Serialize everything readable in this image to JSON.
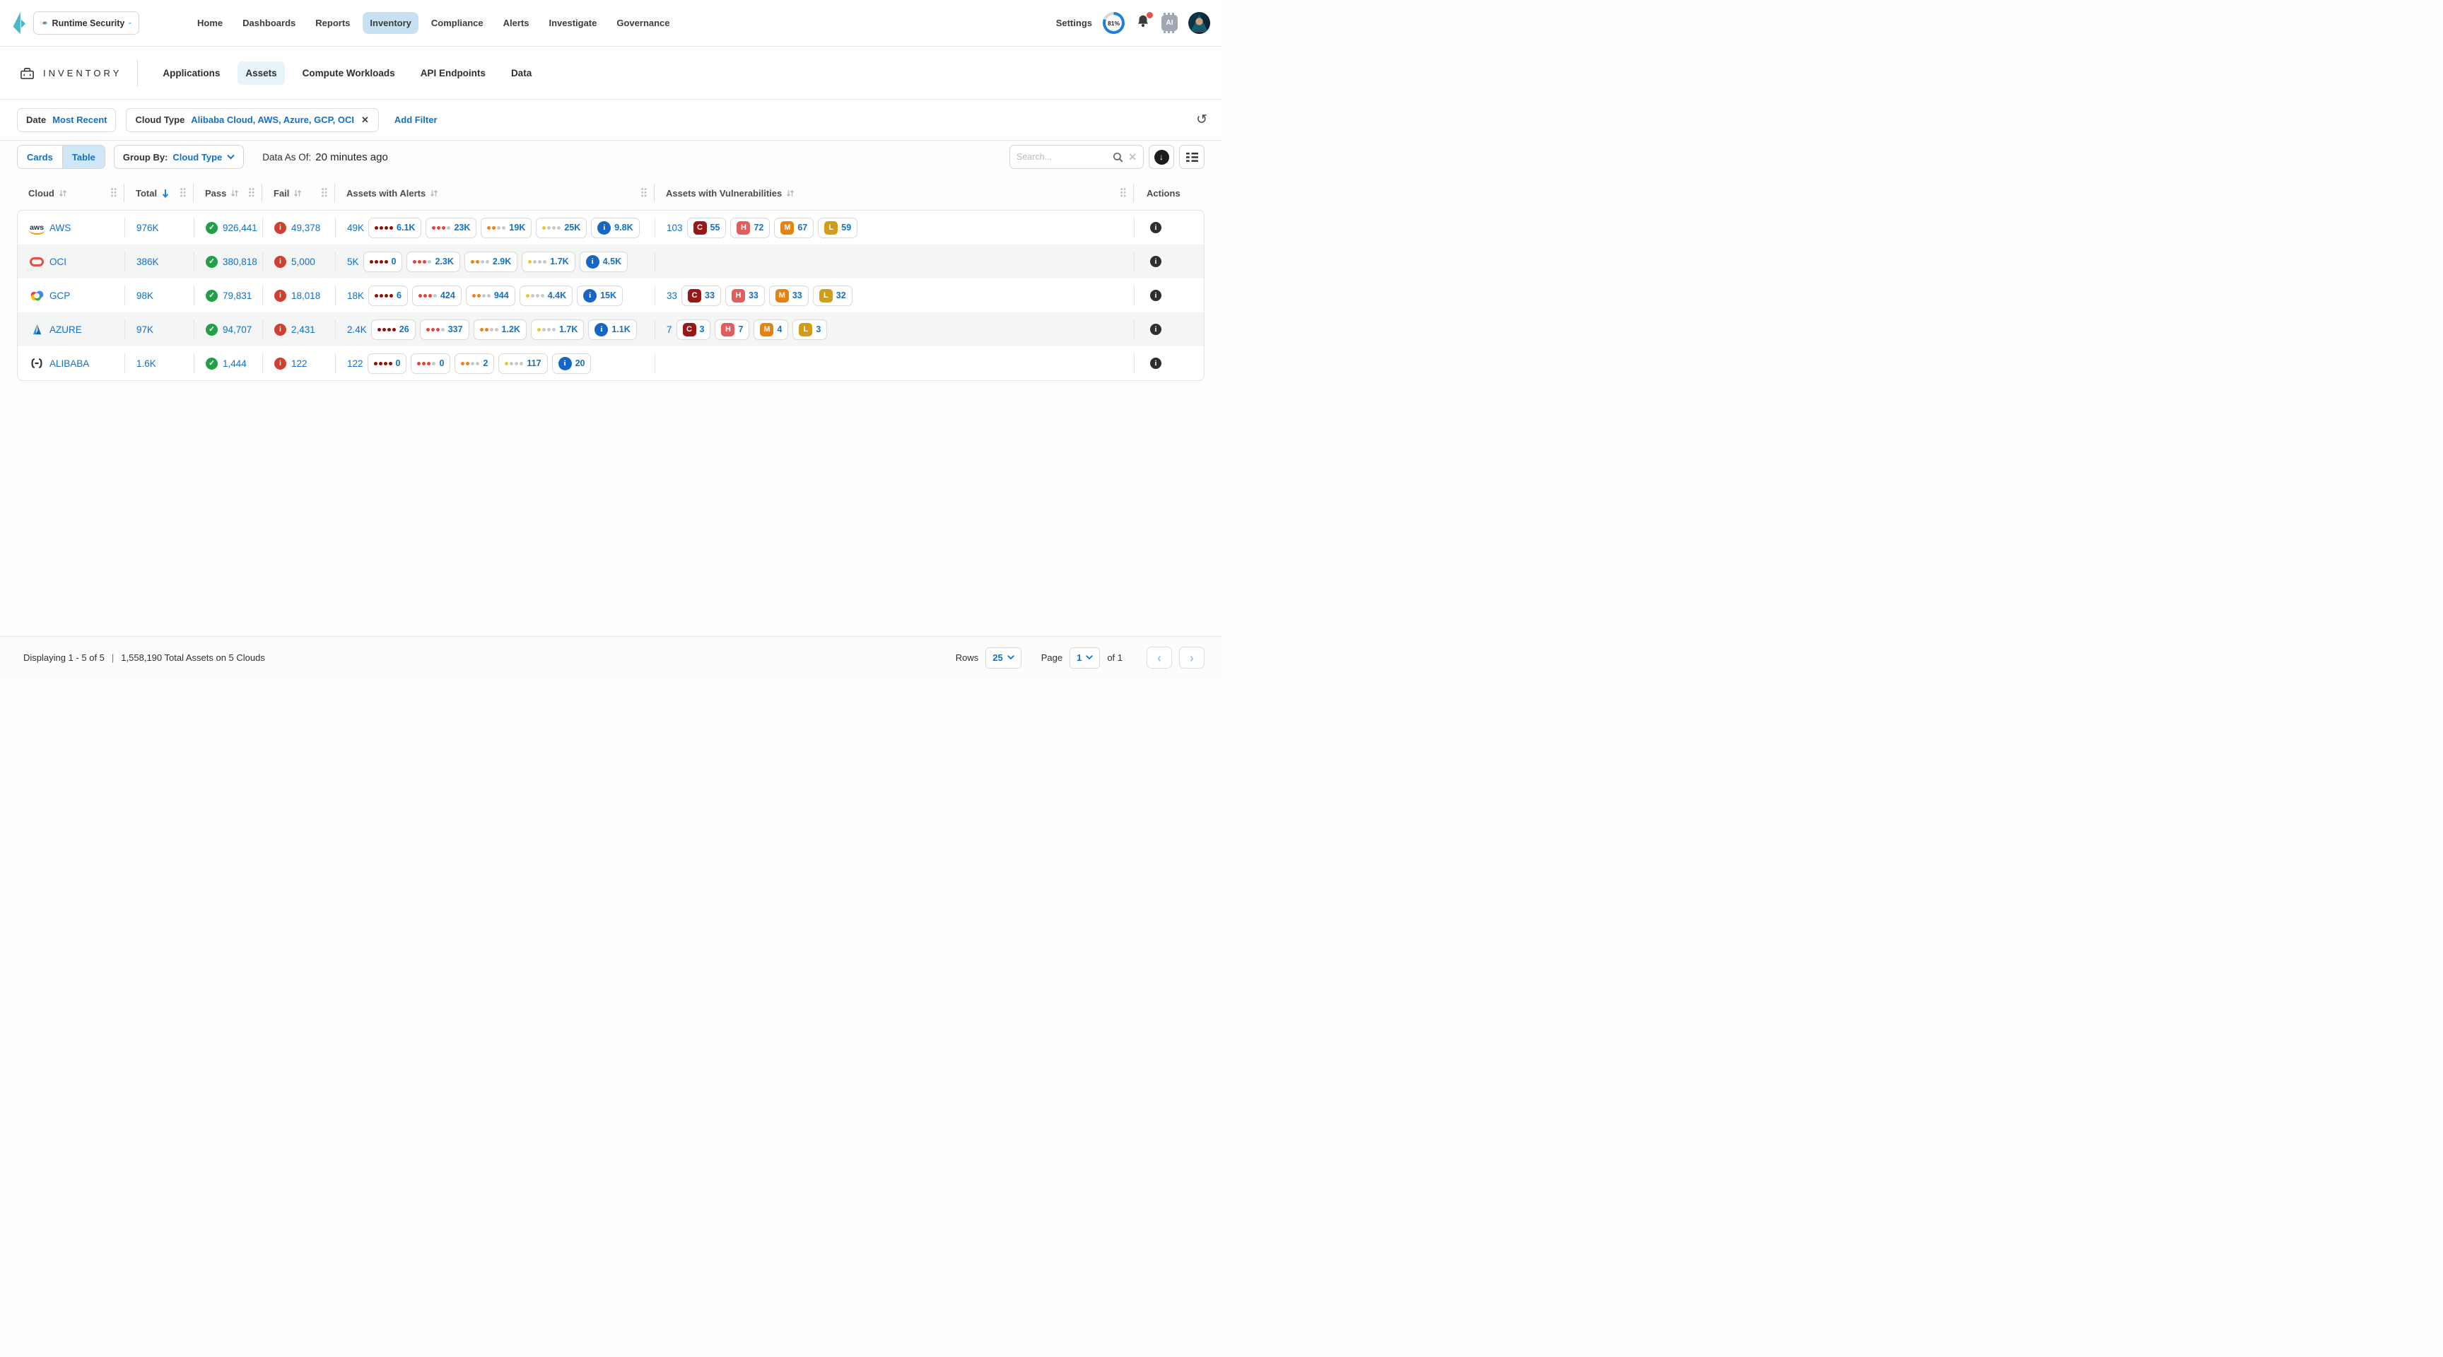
{
  "colors": {
    "accent_blue": "#1171c9",
    "active_nav_bg": "#c6e2f2",
    "active_tab_bg": "#e8f4fb",
    "pass_green": "#23a047",
    "fail_red": "#d23f31",
    "severity_critical": "#8e1010",
    "severity_high": "#e0463e",
    "severity_medium": "#e8821d",
    "severity_low": "#ecc531",
    "severity_info": "#1566c9",
    "brand_teal": "#4db6c8"
  },
  "top_nav": {
    "product_switcher_label": "Runtime Security",
    "items": [
      "Home",
      "Dashboards",
      "Reports",
      "Inventory",
      "Compliance",
      "Alerts",
      "Investigate",
      "Governance"
    ],
    "active_item": "Inventory",
    "settings_label": "Settings",
    "usage_percent": "81%",
    "ai_chip_label": "AI"
  },
  "section_nav": {
    "title": "INVENTORY",
    "tabs": [
      "Applications",
      "Assets",
      "Compute Workloads",
      "API Endpoints",
      "Data"
    ],
    "active_tab": "Assets"
  },
  "filters": {
    "date_label": "Date",
    "date_value": "Most Recent",
    "cloud_type_label": "Cloud Type",
    "cloud_type_value": "Alibaba Cloud, AWS, Azure, GCP, OCI",
    "remove_label": "✕",
    "add_filter_label": "Add Filter"
  },
  "toolbar": {
    "view_cards_label": "Cards",
    "view_table_label": "Table",
    "active_view": "Table",
    "group_by_label": "Group By:",
    "group_by_value": "Cloud Type",
    "data_as_of_label": "Data As Of:",
    "data_as_of_value": "20 minutes ago",
    "search_placeholder": "Search..."
  },
  "severity_letters": {
    "critical": "C",
    "high": "H",
    "medium": "M",
    "low": "L"
  },
  "table": {
    "columns": [
      "Cloud",
      "Total",
      "Pass",
      "Fail",
      "Assets with Alerts",
      "Assets with Vulnerabilities",
      "Actions"
    ],
    "sorted_column": "Total",
    "sort_direction": "descending",
    "rows": [
      {
        "cloud": "AWS",
        "icon": "aws-logo",
        "total": "976K",
        "pass": "926,441",
        "fail": "49,378",
        "alerts": {
          "total": "49K",
          "critical": "6.1K",
          "high": "23K",
          "medium": "19K",
          "low": "25K",
          "info": "9.8K"
        },
        "vulns": {
          "total": "103",
          "critical": "55",
          "high": "72",
          "medium": "67",
          "low": "59"
        }
      },
      {
        "cloud": "OCI",
        "icon": "oci-logo",
        "total": "386K",
        "pass": "380,818",
        "fail": "5,000",
        "alerts": {
          "total": "5K",
          "critical": "0",
          "high": "2.3K",
          "medium": "2.9K",
          "low": "1.7K",
          "info": "4.5K"
        },
        "vulns": null
      },
      {
        "cloud": "GCP",
        "icon": "gcp-logo",
        "total": "98K",
        "pass": "79,831",
        "fail": "18,018",
        "alerts": {
          "total": "18K",
          "critical": "6",
          "high": "424",
          "medium": "944",
          "low": "4.4K",
          "info": "15K"
        },
        "vulns": {
          "total": "33",
          "critical": "33",
          "high": "33",
          "medium": "33",
          "low": "32"
        }
      },
      {
        "cloud": "AZURE",
        "icon": "azure-logo",
        "total": "97K",
        "pass": "94,707",
        "fail": "2,431",
        "alerts": {
          "total": "2.4K",
          "critical": "26",
          "high": "337",
          "medium": "1.2K",
          "low": "1.7K",
          "info": "1.1K"
        },
        "vulns": {
          "total": "7",
          "critical": "3",
          "high": "7",
          "medium": "4",
          "low": "3"
        }
      },
      {
        "cloud": "ALIBABA",
        "icon": "alibaba-logo",
        "total": "1.6K",
        "pass": "1,444",
        "fail": "122",
        "alerts": {
          "total": "122",
          "critical": "0",
          "high": "0",
          "medium": "2",
          "low": "117",
          "info": "20"
        },
        "vulns": null
      }
    ]
  },
  "footer": {
    "displaying": "Displaying 1 - 5 of 5",
    "separator": "|",
    "total_summary": "1,558,190 Total Assets on 5 Clouds",
    "rows_label": "Rows",
    "rows_value": "25",
    "page_label": "Page",
    "page_value": "1",
    "page_total": "of 1",
    "prev_label": "‹",
    "next_label": "›"
  }
}
